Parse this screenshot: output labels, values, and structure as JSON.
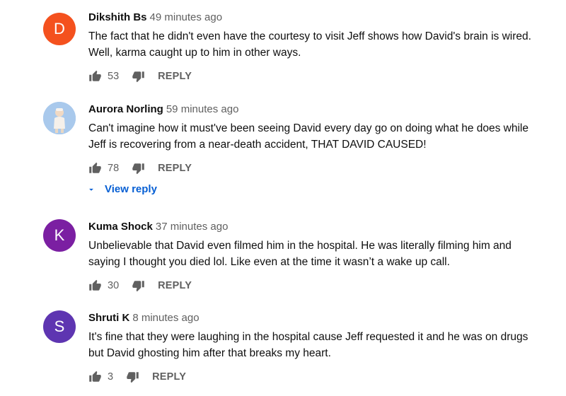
{
  "comments": [
    {
      "author": "Dikshith Bs",
      "time": "49 minutes ago",
      "avatar_letter": "D",
      "avatar_color": "#f4511e",
      "text": "The fact that he didn't even have the courtesy to visit Jeff shows how David's brain is wired. Well, karma caught up to him in other ways.",
      "likes": "53",
      "reply_label": "REPLY"
    },
    {
      "author": "Aurora Norling",
      "time": "59 minutes ago",
      "avatar_letter": "",
      "avatar_color": "#a7c7ea",
      "text": "Can't imagine how it must've been seeing David every day go on doing what he does while Jeff is recovering from a near-death accident, THAT DAVID CAUSED!",
      "likes": "78",
      "reply_label": "REPLY",
      "view_reply_label": "View reply"
    },
    {
      "author": "Kuma Shock",
      "time": "37 minutes ago",
      "avatar_letter": "K",
      "avatar_color": "#7b1fa2",
      "text": "Unbelievable that David even filmed him in the hospital. He was literally filming him and saying I thought you died lol. Like even at the time it wasn’t a wake up call.",
      "likes": "30",
      "reply_label": "REPLY"
    },
    {
      "author": "Shruti K",
      "time": "8 minutes ago",
      "avatar_letter": "S",
      "avatar_color": "#5e35b1",
      "text": "It's fine that they were laughing in the hospital cause Jeff requested it and he was on drugs but David ghosting him after that breaks my heart.",
      "likes": "3",
      "reply_label": "REPLY"
    }
  ],
  "icons": {
    "like": "thumb-up-icon",
    "dislike": "thumb-down-icon",
    "expand": "caret-down-icon"
  }
}
